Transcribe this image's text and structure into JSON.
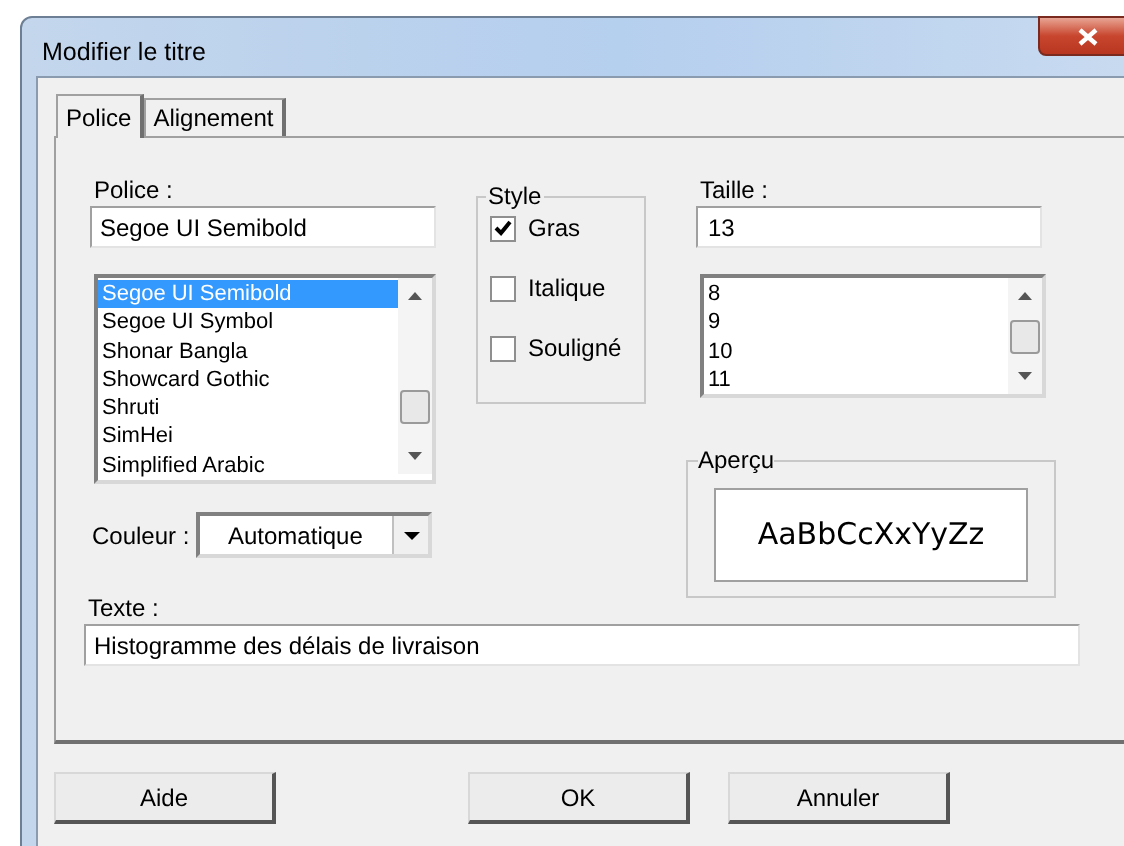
{
  "window": {
    "title": "Modifier le titre"
  },
  "tabs": [
    {
      "label": "Police",
      "selected": true
    },
    {
      "label": "Alignement",
      "selected": false
    }
  ],
  "font": {
    "label": "Police :",
    "value": "Segoe UI Semibold",
    "items": [
      {
        "label": "Segoe UI Semibold",
        "selected": true
      },
      {
        "label": "Segoe UI Symbol",
        "selected": false
      },
      {
        "label": "Shonar Bangla",
        "selected": false
      },
      {
        "label": "Showcard Gothic",
        "selected": false
      },
      {
        "label": "Shruti",
        "selected": false
      },
      {
        "label": "SimHei",
        "selected": false
      },
      {
        "label": "Simplified Arabic",
        "selected": false
      }
    ]
  },
  "style": {
    "title": "Style",
    "options": [
      {
        "label": "Gras",
        "checked": true
      },
      {
        "label": "Italique",
        "checked": false
      },
      {
        "label": "Souligné",
        "checked": false
      }
    ]
  },
  "size": {
    "label": "Taille :",
    "value": "13",
    "items": [
      {
        "label": "8",
        "selected": false
      },
      {
        "label": "9",
        "selected": false
      },
      {
        "label": "10",
        "selected": false
      },
      {
        "label": "11",
        "selected": false
      }
    ]
  },
  "color": {
    "label": "Couleur :",
    "value": "Automatique"
  },
  "preview": {
    "title": "Aperçu",
    "sample": "AaBbCcXxYyZz"
  },
  "text": {
    "label": "Texte :",
    "value": "Histogramme des délais de livraison"
  },
  "buttons": [
    "Aide",
    "OK",
    "Annuler"
  ]
}
